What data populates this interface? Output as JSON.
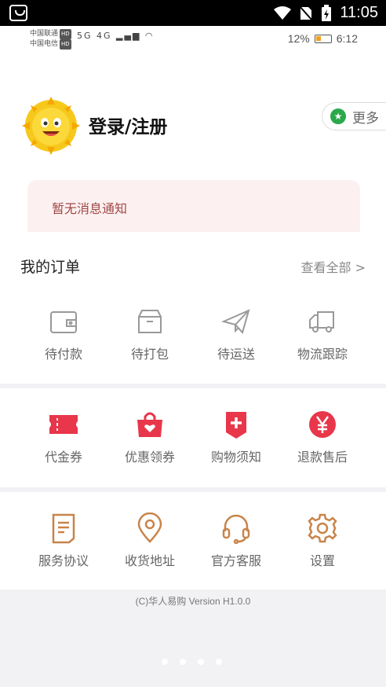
{
  "system_bar": {
    "time": "11:05"
  },
  "inner_status": {
    "carrier1": "中国联通",
    "carrier2": "中国电信",
    "hd": "HD",
    "signal": "5G 4G",
    "battery_pct": "12%",
    "time": "6:12",
    "battery_level": 0.12,
    "battery_color": "#f0a020"
  },
  "header": {
    "login_label": "登录/注册",
    "more_label": "更多",
    "notice_text": "暂无消息通知"
  },
  "orders": {
    "title": "我的订单",
    "view_all": "查看全部 >",
    "items": [
      {
        "label": "待付款",
        "icon": "wallet-icon"
      },
      {
        "label": "待打包",
        "icon": "box-icon"
      },
      {
        "label": "待运送",
        "icon": "paper-plane-icon"
      },
      {
        "label": "物流跟踪",
        "icon": "truck-icon"
      }
    ]
  },
  "services": {
    "items": [
      {
        "label": "代金券",
        "icon": "voucher-icon"
      },
      {
        "label": "优惠领券",
        "icon": "shopping-bag-icon"
      },
      {
        "label": "购物须知",
        "icon": "notice-badge-icon"
      },
      {
        "label": "退款售后",
        "icon": "yen-icon"
      }
    ],
    "accent": "#e8364a"
  },
  "settings": {
    "items": [
      {
        "label": "服务协议",
        "icon": "document-icon"
      },
      {
        "label": "收货地址",
        "icon": "location-pin-icon"
      },
      {
        "label": "官方客服",
        "icon": "headset-icon"
      },
      {
        "label": "设置",
        "icon": "gear-icon"
      }
    ],
    "accent": "#c8844a"
  },
  "footer": {
    "version": "(C)华人易购 Version H1.0.0"
  }
}
